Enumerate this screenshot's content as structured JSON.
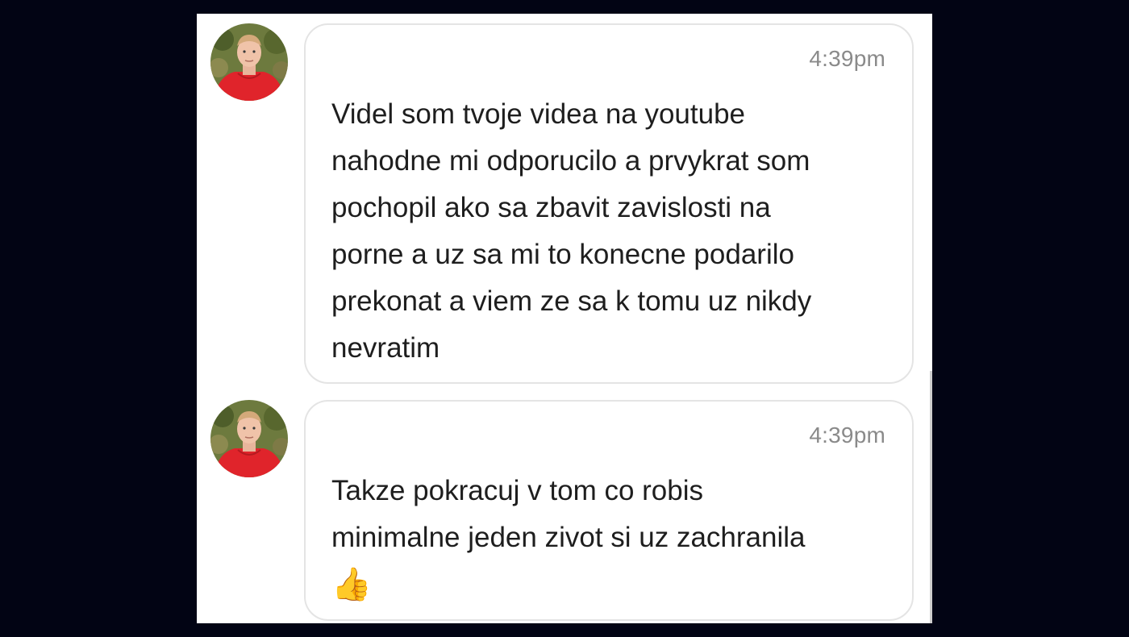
{
  "colors": {
    "background": "#020414",
    "panel": "#ffffff",
    "bubble_border": "#e4e4e4",
    "text": "#1e1e1e",
    "timestamp": "#8a8a8a",
    "hoodie_red": "#e0242b"
  },
  "messages": [
    {
      "avatar_icon": "user-avatar-photo",
      "timestamp": "4:39pm",
      "text": "Videl som tvoje videa na youtube\nnahodne mi odporucilo a prvykrat som\npochopil ako sa zbavit zavislosti na\nporne a uz sa mi to konecne podarilo\nprekonat a viem ze sa k tomu uz nikdy\nnevratim"
    },
    {
      "avatar_icon": "user-avatar-photo",
      "timestamp": "4:39pm",
      "text": "Takze pokracuj v tom co robis\nminimalne jeden zivot si uz zachranila",
      "emoji": "👍",
      "emoji_icon": "thumbs-up-icon"
    }
  ]
}
